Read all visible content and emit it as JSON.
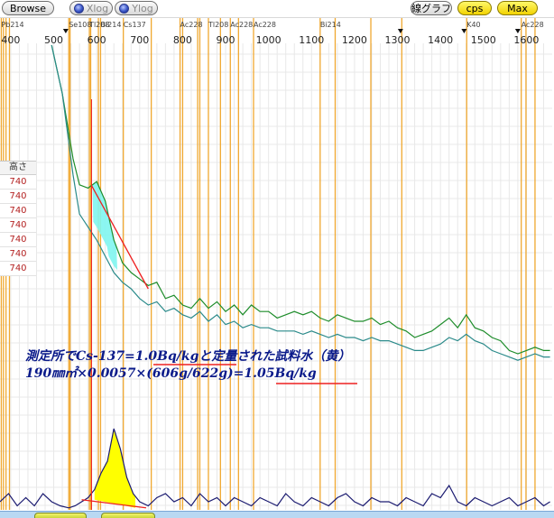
{
  "toolbar": {
    "browse": "Browse",
    "xlog": "Xlog",
    "ylog": "Ylog",
    "line_graph": "線グラフ",
    "cps": "cps",
    "max": "Max"
  },
  "colors": {
    "peak_marker": "#f0a830",
    "gross_spectrum": "#1d8c2a",
    "background_spectrum": "#2a8a8a",
    "residual_spectrum": "#1a1a70",
    "cs137_area_fill": "#7ff5f0",
    "residual_area_fill": "#ffff00",
    "baseline_line": "#ee2020",
    "annotation_text": "#0a1a8a",
    "grid": "#e8e8e8"
  },
  "left_table": {
    "header": "高さ",
    "values": [
      "740",
      "740",
      "740",
      "740",
      "740",
      "740",
      "740"
    ]
  },
  "annotation": {
    "line1_pre": "測定所でCs-137=",
    "line1_value": "1.0Bq/kg",
    "line1_post": "と定量された試料水（黄）",
    "line2_pre": "190㎜㎡×0.0057×(606g/622g)=",
    "line2_value": "1.05Bq/kg"
  },
  "chart_data": {
    "type": "line",
    "xlim": [
      375,
      1660
    ],
    "x_ticks": [
      400,
      500,
      600,
      700,
      800,
      900,
      1000,
      1100,
      1200,
      1300,
      1400,
      1500,
      1600
    ],
    "grid": true,
    "peak_labels": [
      {
        "label": "Pb214",
        "energy": 378
      },
      {
        "label": "Se108",
        "energy": 535
      },
      {
        "label": "Tl208",
        "energy": 583
      },
      {
        "label": "Bi214",
        "energy": 609
      },
      {
        "label": "Cs137",
        "energy": 662
      },
      {
        "label": "Ac228",
        "energy": 794
      },
      {
        "label": "Tl208",
        "energy": 860
      },
      {
        "label": "Ac228",
        "energy": 911
      },
      {
        "label": "Ac228",
        "energy": 965
      },
      {
        "label": "Bi214",
        "energy": 1120
      },
      {
        "label": "K40",
        "energy": 1461
      },
      {
        "label": "Ac228",
        "energy": 1588
      }
    ],
    "marker_lines": [
      378,
      383,
      389,
      397,
      535,
      538,
      583,
      586,
      604,
      609,
      662,
      727,
      794,
      800,
      835,
      840,
      860,
      888,
      911,
      930,
      965,
      1120,
      1155,
      1238,
      1310,
      1461,
      1588,
      1599,
      1620
    ],
    "triangle_markers": [
      528,
      1307,
      1455,
      1580
    ],
    "series": [
      {
        "x": [
          495,
          520,
          545,
          560,
          580,
          600,
          620,
          640,
          660,
          680,
          700,
          720,
          740,
          760,
          780,
          800,
          820,
          840,
          860,
          880,
          900,
          920,
          940,
          960,
          980,
          1000,
          1020,
          1040,
          1060,
          1080,
          1100,
          1120,
          1140,
          1160,
          1180,
          1200,
          1220,
          1240,
          1260,
          1280,
          1300,
          1320,
          1340,
          1360,
          1380,
          1400,
          1420,
          1440,
          1460,
          1480,
          1500,
          1520,
          1540,
          1560,
          1580,
          1600,
          1620,
          1640,
          1655
        ],
        "values": [
          100,
          85,
          65,
          57,
          56,
          58,
          52,
          40,
          33,
          30,
          28,
          26,
          27,
          22,
          23,
          20,
          19,
          22,
          19,
          21,
          18,
          20,
          17,
          20,
          18,
          18,
          16,
          17,
          18,
          17,
          18,
          16,
          15,
          17,
          16,
          15,
          15,
          16,
          14,
          15,
          13,
          12,
          10,
          11,
          12,
          14,
          16,
          13,
          17,
          13,
          12,
          10,
          9,
          6,
          5,
          6,
          7,
          6,
          6
        ]
      },
      {
        "x": [
          495,
          520,
          545,
          560,
          580,
          600,
          620,
          640,
          660,
          680,
          700,
          720,
          740,
          760,
          780,
          800,
          820,
          840,
          860,
          880,
          900,
          920,
          940,
          960,
          980,
          1000,
          1020,
          1040,
          1060,
          1080,
          1100,
          1120,
          1140,
          1160,
          1180,
          1200,
          1220,
          1240,
          1260,
          1280,
          1300,
          1320,
          1340,
          1360,
          1380,
          1400,
          1420,
          1440,
          1460,
          1480,
          1500,
          1520,
          1540,
          1560,
          1580,
          1600,
          1620,
          1640,
          1655
        ],
        "values": [
          100,
          85,
          60,
          48,
          44,
          40,
          35,
          30,
          27,
          25,
          22,
          20,
          21,
          18,
          19,
          17,
          16,
          18,
          15,
          17,
          14,
          15,
          13,
          14,
          13,
          13,
          12,
          12,
          12,
          11,
          12,
          11,
          10,
          11,
          10,
          10,
          9,
          10,
          9,
          9,
          8,
          7,
          6,
          6,
          7,
          8,
          10,
          9,
          11,
          9,
          8,
          6,
          5,
          4,
          3,
          4,
          5,
          4,
          4
        ]
      },
      {
        "x": [
          375,
          395,
          415,
          435,
          455,
          475,
          495,
          515,
          535,
          550,
          565,
          580,
          595,
          610,
          625,
          640,
          655,
          670,
          685,
          700,
          720,
          740,
          760,
          780,
          800,
          820,
          840,
          860,
          880,
          900,
          920,
          940,
          960,
          980,
          1000,
          1020,
          1040,
          1060,
          1080,
          1100,
          1120,
          1140,
          1160,
          1180,
          1200,
          1220,
          1240,
          1260,
          1280,
          1300,
          1320,
          1340,
          1360,
          1380,
          1400,
          1420,
          1440,
          1460,
          1480,
          1500,
          1520,
          1540,
          1560,
          1580,
          1600,
          1620,
          1640,
          1655
        ],
        "values": [
          2,
          4,
          1,
          3,
          1,
          4,
          2,
          1,
          0.5,
          1,
          2,
          3,
          5,
          9,
          12,
          20,
          15,
          8,
          4,
          2,
          1,
          3,
          4,
          2,
          3,
          1,
          4,
          2,
          3,
          1,
          3,
          2,
          1,
          3,
          2,
          1,
          4,
          2,
          1,
          3,
          2,
          1,
          3,
          4,
          2,
          1,
          3,
          2,
          2,
          1,
          3,
          2,
          1,
          4,
          3,
          6,
          2,
          1,
          3,
          2,
          1,
          2,
          3,
          1,
          2,
          3,
          1,
          2
        ]
      }
    ]
  }
}
